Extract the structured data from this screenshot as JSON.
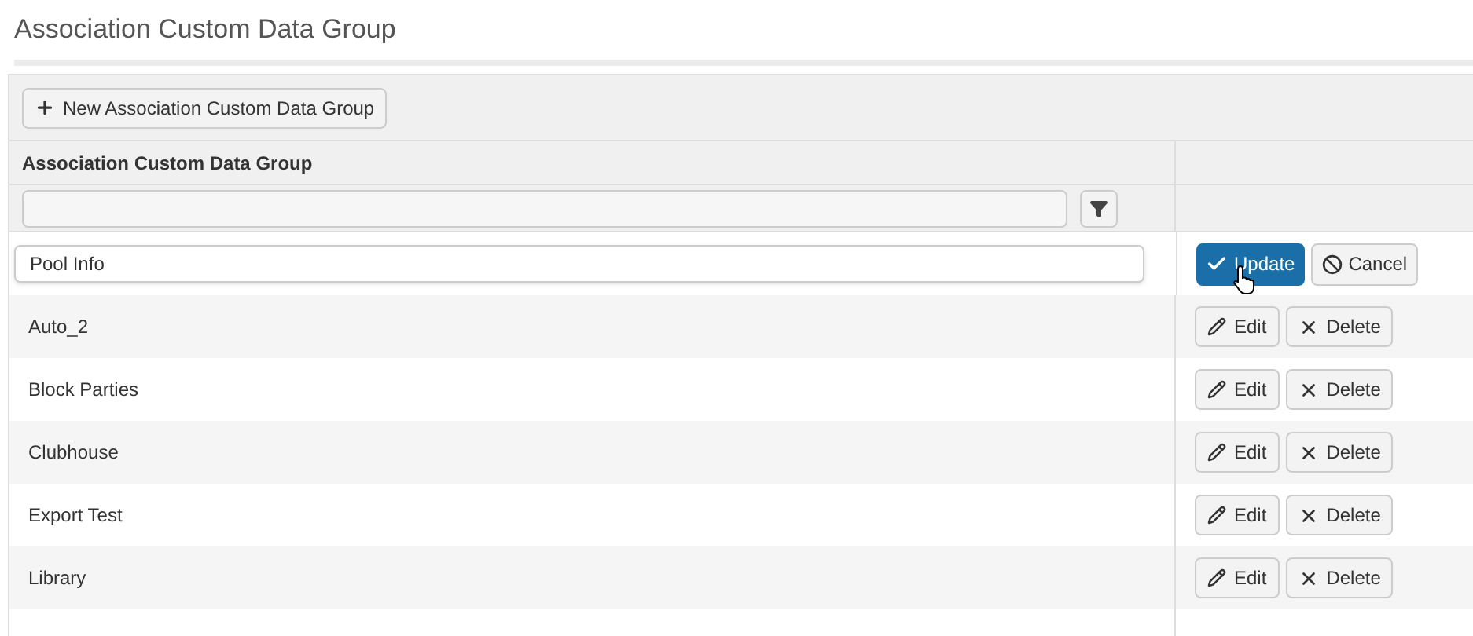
{
  "page_title": "Association Custom Data Group",
  "toolbar": {
    "new_button": "New Association Custom Data Group"
  },
  "table": {
    "columns": [
      "Association Custom Data Group"
    ],
    "rows": [
      {
        "kind": "editing",
        "value": "Pool Info",
        "actions": [
          "Update",
          "Cancel"
        ]
      },
      {
        "kind": "view",
        "name": "Auto_2",
        "actions": [
          "Edit",
          "Delete"
        ]
      },
      {
        "kind": "view",
        "name": "Block Parties",
        "actions": [
          "Edit",
          "Delete"
        ]
      },
      {
        "kind": "view",
        "name": "Clubhouse",
        "actions": [
          "Edit",
          "Delete"
        ]
      },
      {
        "kind": "view",
        "name": "Export Test",
        "actions": [
          "Edit",
          "Delete"
        ]
      },
      {
        "kind": "view",
        "name": "Library",
        "actions": [
          "Edit",
          "Delete"
        ]
      }
    ]
  }
}
